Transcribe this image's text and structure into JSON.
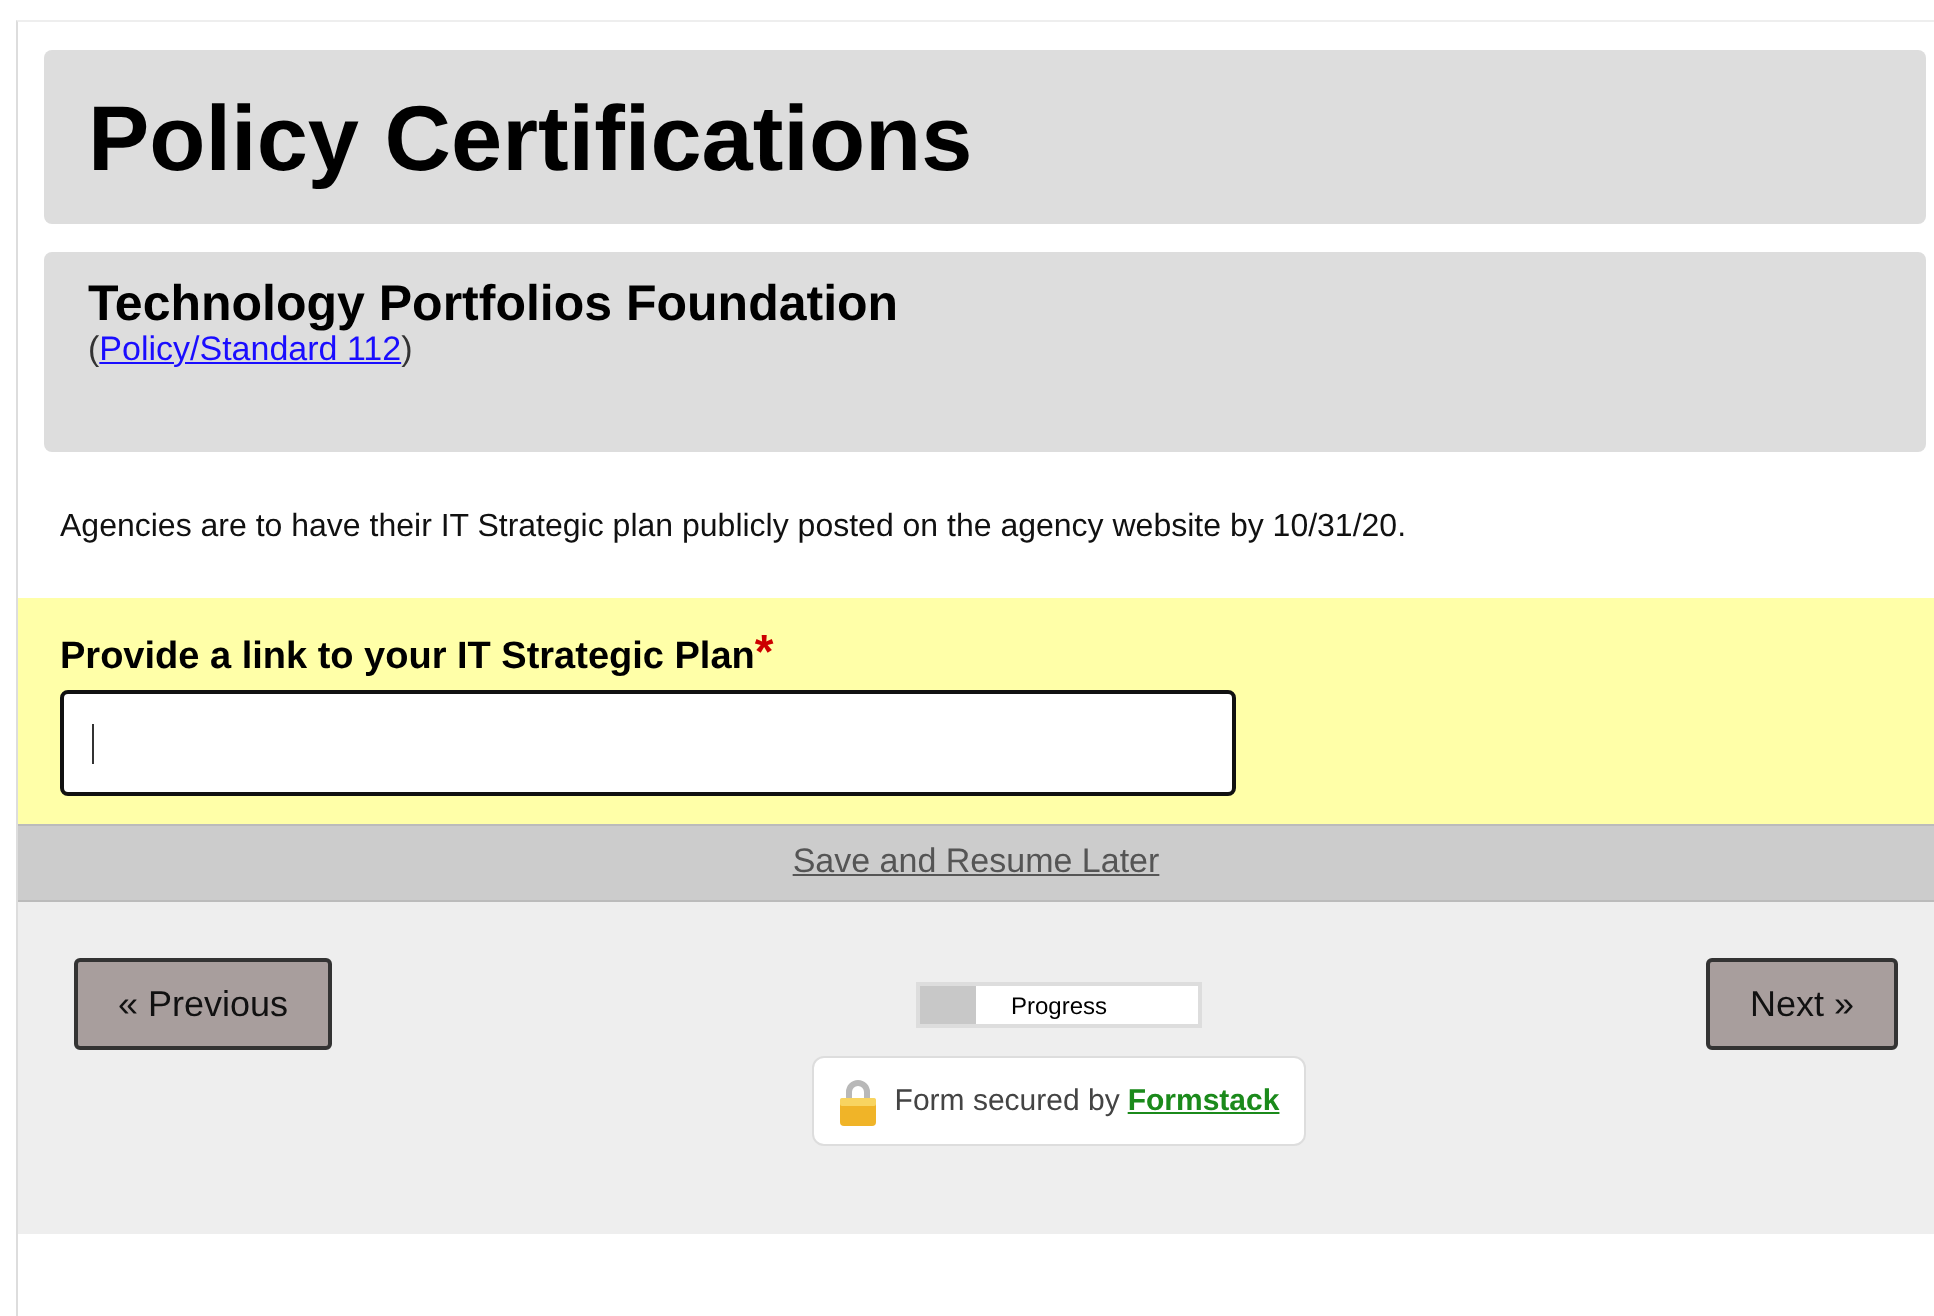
{
  "title": "Policy Certifications",
  "section": {
    "heading": "Technology Portfolios Foundation",
    "link_prefix": "(",
    "link": "Policy/Standard 112",
    "link_suffix": ")"
  },
  "description": "Agencies are to have their IT Strategic plan publicly posted on the agency website by 10/31/20.",
  "field": {
    "label": "Provide a link to your IT Strategic Plan",
    "required_mark": "*",
    "focused": true
  },
  "save_link": "Save and Resume Later",
  "navigation": {
    "previous": "« Previous",
    "next": "Next »"
  },
  "progress": {
    "label": "Progress",
    "level": 0.2
  },
  "secured": {
    "text": "Form secured by",
    "link": "Formstack"
  }
}
